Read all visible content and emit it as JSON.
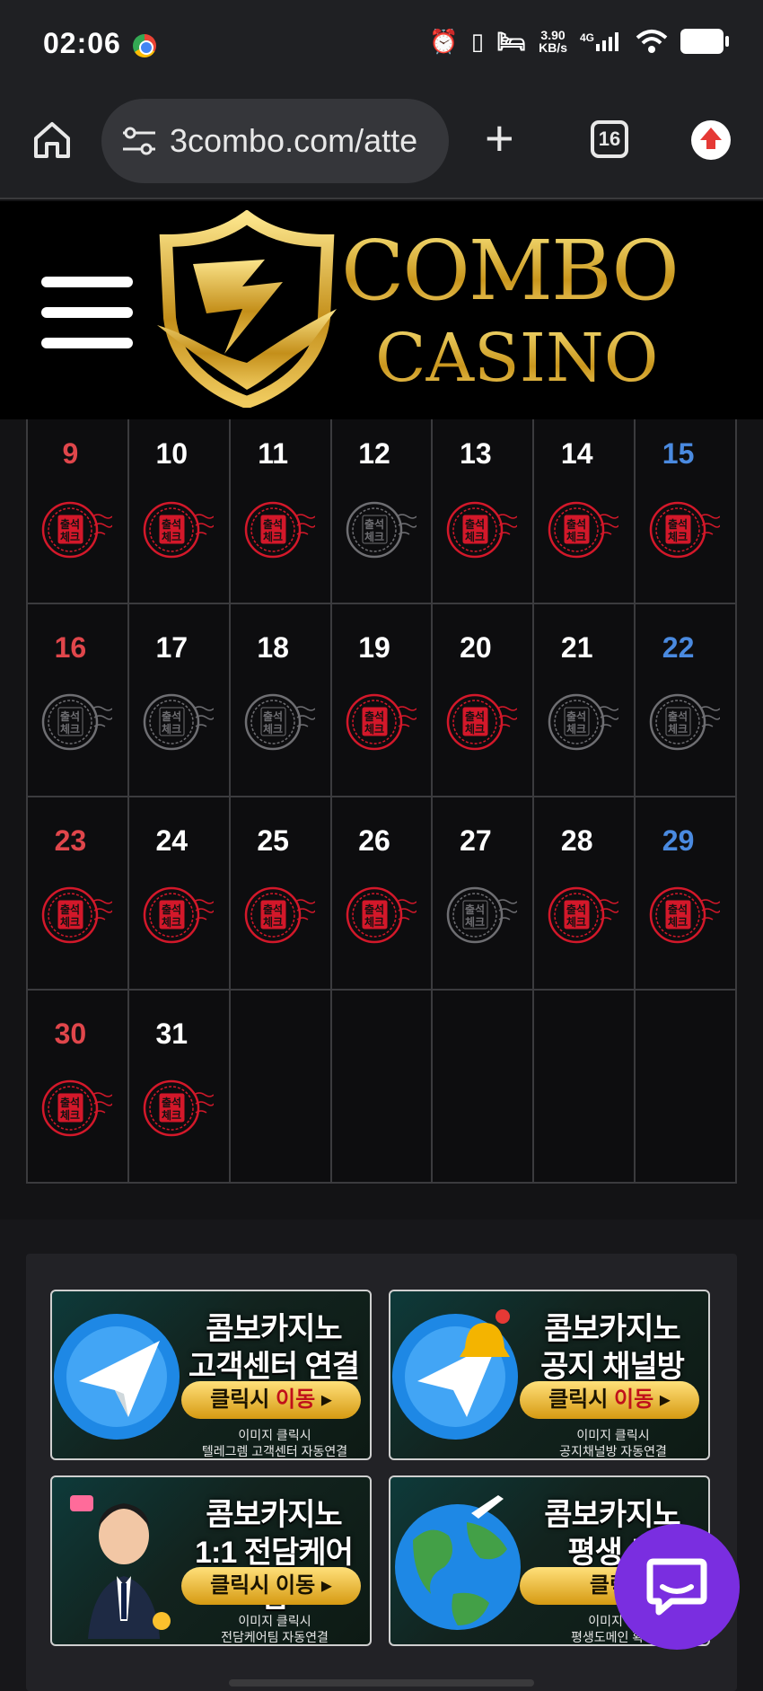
{
  "status_bar": {
    "time": "02:06",
    "net_speed_top": "3.90",
    "net_speed_bottom": "KB/s",
    "network_type": "4G"
  },
  "browser": {
    "url": "3combo.com/atte",
    "tab_count": "16"
  },
  "site": {
    "logo_line1": "COMBO",
    "logo_line2": "CASINO"
  },
  "calendar": {
    "stamp_text_top": "출석",
    "stamp_text_bottom": "체크",
    "weeks": [
      [
        {
          "day": "9",
          "type": "sun",
          "checked": true
        },
        {
          "day": "10",
          "type": "week",
          "checked": true
        },
        {
          "day": "11",
          "type": "week",
          "checked": true
        },
        {
          "day": "12",
          "type": "week",
          "checked": false
        },
        {
          "day": "13",
          "type": "week",
          "checked": true
        },
        {
          "day": "14",
          "type": "week",
          "checked": true
        },
        {
          "day": "15",
          "type": "sat",
          "checked": true
        }
      ],
      [
        {
          "day": "16",
          "type": "sun",
          "checked": false
        },
        {
          "day": "17",
          "type": "week",
          "checked": false
        },
        {
          "day": "18",
          "type": "week",
          "checked": false
        },
        {
          "day": "19",
          "type": "week",
          "checked": true
        },
        {
          "day": "20",
          "type": "week",
          "checked": true
        },
        {
          "day": "21",
          "type": "week",
          "checked": false
        },
        {
          "day": "22",
          "type": "sat",
          "checked": false
        }
      ],
      [
        {
          "day": "23",
          "type": "sun",
          "checked": true
        },
        {
          "day": "24",
          "type": "week",
          "checked": true
        },
        {
          "day": "25",
          "type": "week",
          "checked": true
        },
        {
          "day": "26",
          "type": "week",
          "checked": true
        },
        {
          "day": "27",
          "type": "week",
          "checked": false
        },
        {
          "day": "28",
          "type": "week",
          "checked": true
        },
        {
          "day": "29",
          "type": "sat",
          "checked": true
        }
      ],
      [
        {
          "day": "30",
          "type": "sun",
          "checked": true
        },
        {
          "day": "31",
          "type": "week",
          "checked": true
        },
        {
          "day": "",
          "type": "empty"
        },
        {
          "day": "",
          "type": "empty"
        },
        {
          "day": "",
          "type": "empty"
        },
        {
          "day": "",
          "type": "empty"
        },
        {
          "day": "",
          "type": "empty"
        }
      ]
    ]
  },
  "banners": [
    {
      "title1": "콤보카지노",
      "title2": "고객센터 연결",
      "btn_a": "클릭시 ",
      "btn_b": "이동",
      "btn_red": true,
      "sub1": "이미지 클릭시",
      "sub2": "텔레그렘 고객센터 자동연결",
      "art": "telegram"
    },
    {
      "title1": "콤보카지노",
      "title2": "공지 채널방",
      "btn_a": "클릭시 ",
      "btn_b": "이동",
      "btn_red": true,
      "sub1": "이미지 클릭시",
      "sub2": "공지채널방 자동연결",
      "art": "telegram-bell"
    },
    {
      "title1": "콤보카지노",
      "title2": "1:1 전담케어팀",
      "btn_a": "클릭시 ",
      "btn_b": "이동",
      "btn_red": false,
      "sub1": "이미지 클릭시",
      "sub2": "전담케어팀 자동연결",
      "art": "agent"
    },
    {
      "title1": "콤보카지노",
      "title2": "평생 도",
      "btn_a": "클릭",
      "btn_b": "",
      "btn_red": false,
      "sub1": "이미지 클",
      "sub2": "평생도메인 확시 ",
      "art": "globe"
    }
  ],
  "colors": {
    "checked_stamp": "#d3182a",
    "unchecked_stamp": "#6e6e72",
    "chat_fab": "#7a2ee0"
  }
}
